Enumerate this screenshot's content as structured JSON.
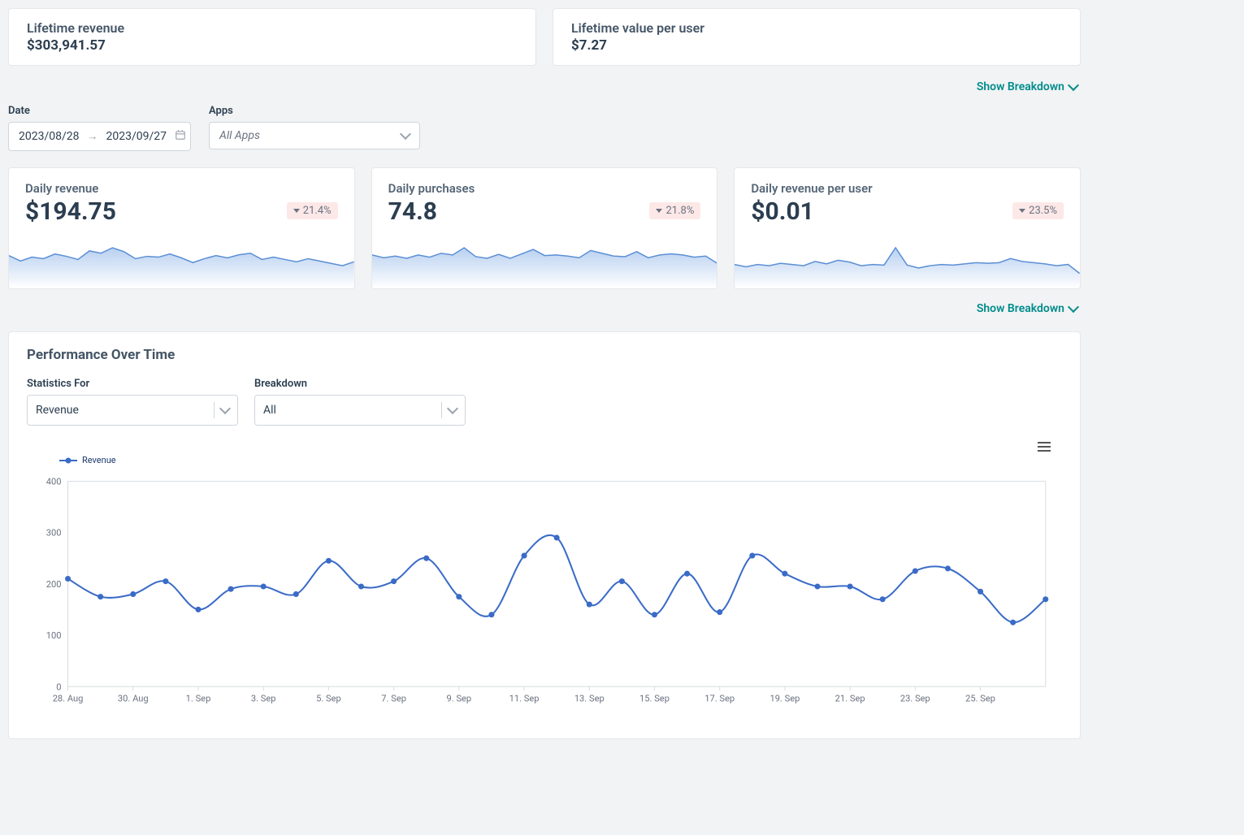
{
  "lifetime": {
    "revenue_label": "Lifetime revenue",
    "revenue_value": "$303,941.57",
    "lvpu_label": "Lifetime value per user",
    "lvpu_value": "$7.27"
  },
  "breakdown_label": "Show Breakdown",
  "filters": {
    "date_label": "Date",
    "date_start": "2023/08/28",
    "date_end": "2023/09/27",
    "apps_label": "Apps",
    "apps_value": "All Apps"
  },
  "daily": {
    "rev_label": "Daily revenue",
    "rev_value": "$194.75",
    "rev_change": "21.4%",
    "pur_label": "Daily purchases",
    "pur_value": "74.8",
    "pur_change": "21.8%",
    "rpu_label": "Daily revenue per user",
    "rpu_value": "$0.01",
    "rpu_change": "23.5%"
  },
  "perf": {
    "title": "Performance Over Time",
    "stats_label": "Statistics For",
    "stats_value": "Revenue",
    "breakdown_label": "Breakdown",
    "breakdown_value": "All",
    "legend": "Revenue"
  },
  "chart_data": {
    "type": "line",
    "title": "Performance Over Time",
    "xlabel": "",
    "ylabel": "",
    "ylim": [
      0,
      400
    ],
    "yticks": [
      0,
      100,
      200,
      300,
      400
    ],
    "x_tick_labels": [
      "28. Aug",
      "30. Aug",
      "1. Sep",
      "3. Sep",
      "5. Sep",
      "7. Sep",
      "9. Sep",
      "11. Sep",
      "13. Sep",
      "15. Sep",
      "17. Sep",
      "19. Sep",
      "21. Sep",
      "23. Sep",
      "25. Sep"
    ],
    "series": [
      {
        "name": "Revenue",
        "x": [
          "2023-08-28",
          "2023-08-29",
          "2023-08-30",
          "2023-08-31",
          "2023-09-01",
          "2023-09-02",
          "2023-09-03",
          "2023-09-04",
          "2023-09-05",
          "2023-09-06",
          "2023-09-07",
          "2023-09-08",
          "2023-09-09",
          "2023-09-10",
          "2023-09-11",
          "2023-09-12",
          "2023-09-13",
          "2023-09-14",
          "2023-09-15",
          "2023-09-16",
          "2023-09-17",
          "2023-09-18",
          "2023-09-19",
          "2023-09-20",
          "2023-09-21",
          "2023-09-22",
          "2023-09-23",
          "2023-09-24",
          "2023-09-25",
          "2023-09-26",
          "2023-09-27"
        ],
        "values": [
          210,
          175,
          180,
          205,
          150,
          190,
          195,
          180,
          245,
          195,
          205,
          250,
          175,
          140,
          255,
          290,
          160,
          205,
          140,
          220,
          145,
          255,
          220,
          195,
          195,
          170,
          225,
          230,
          185,
          125,
          170
        ]
      }
    ]
  },
  "sparklines": {
    "rev": [
      42,
      35,
      40,
      38,
      44,
      41,
      37,
      48,
      45,
      52,
      47,
      38,
      41,
      40,
      44,
      39,
      33,
      38,
      42,
      39,
      43,
      45,
      37,
      40,
      37,
      34,
      38,
      35,
      32,
      29,
      34
    ],
    "pur": [
      60,
      55,
      58,
      54,
      60,
      56,
      63,
      60,
      73,
      57,
      54,
      61,
      54,
      62,
      70,
      59,
      60,
      58,
      55,
      68,
      63,
      58,
      57,
      66,
      55,
      60,
      62,
      60,
      56,
      58,
      45
    ],
    "rpu": [
      40,
      36,
      40,
      38,
      42,
      40,
      38,
      45,
      41,
      47,
      44,
      38,
      40,
      39,
      68,
      39,
      34,
      38,
      40,
      39,
      41,
      43,
      42,
      43,
      50,
      45,
      43,
      41,
      38,
      40,
      25
    ]
  }
}
